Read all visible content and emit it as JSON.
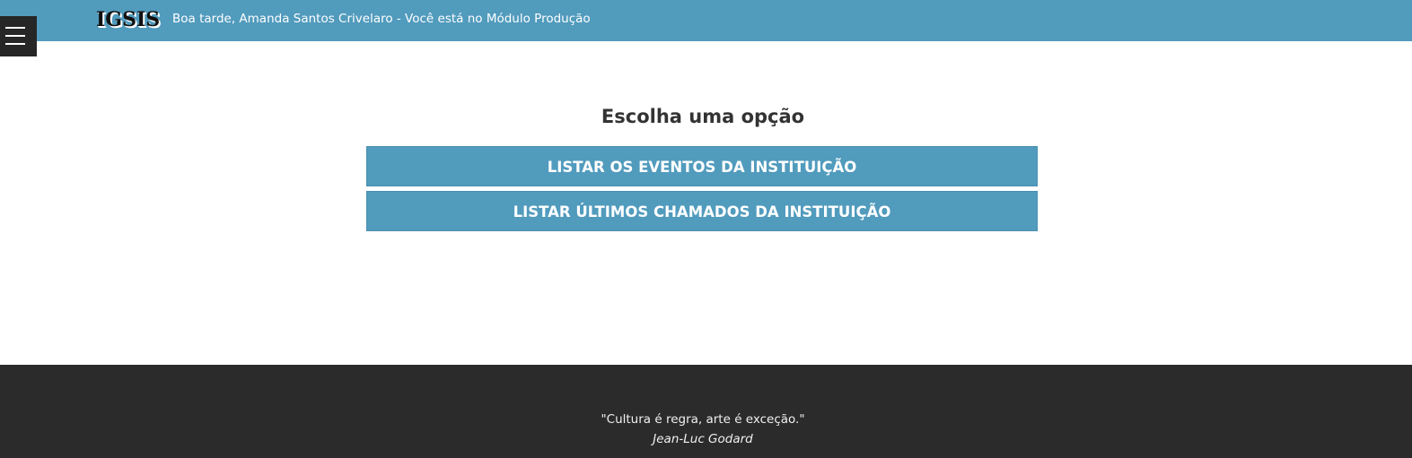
{
  "header": {
    "logo": "IGSIS",
    "greeting": "Boa tarde, Amanda Santos Crivelaro - Você está no Módulo Produção",
    "bar_color": "#519bbd",
    "menu_icon": "hamburger-menu-icon"
  },
  "main": {
    "title": "Escolha uma opção",
    "options": [
      {
        "label": "LISTAR OS EVENTOS DA INSTITUIÇÃO"
      },
      {
        "label": "LISTAR ÚLTIMOS CHAMADOS DA INSTITUIÇÃO"
      }
    ],
    "button_color": "#519bbd"
  },
  "footer": {
    "quote": "\"Cultura é regra, arte é exceção.\"",
    "author": "Jean-Luc Godard",
    "background_color": "#2b2b2b"
  }
}
